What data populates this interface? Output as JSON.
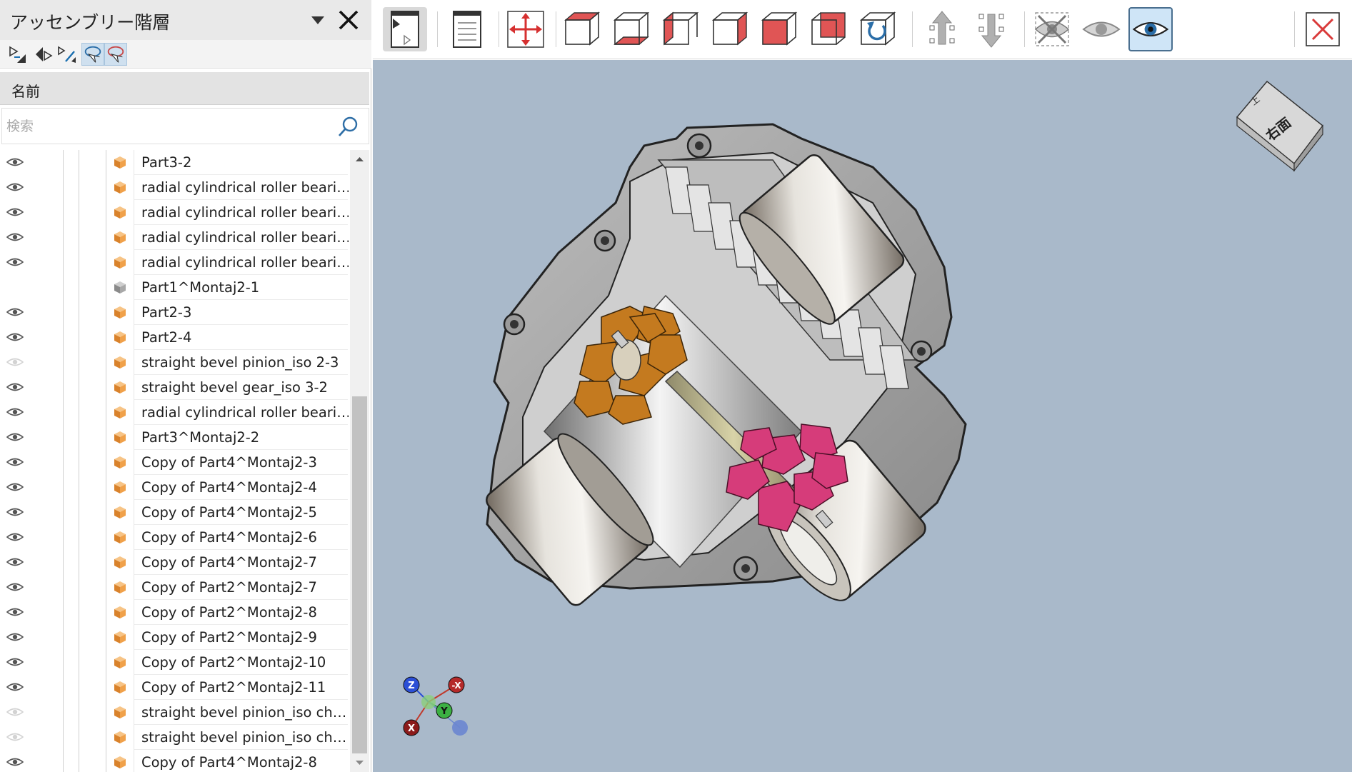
{
  "panel": {
    "title": "アッセンブリー階層",
    "column_header": "名前",
    "search_placeholder": "検索"
  },
  "tree": {
    "rows": [
      {
        "label": "Part3-2",
        "visible": true,
        "icon": "orange-part-icon"
      },
      {
        "label": "radial cylindrical roller beari…",
        "visible": true,
        "icon": "orange-part-icon"
      },
      {
        "label": "radial cylindrical roller beari…",
        "visible": true,
        "icon": "orange-part-icon"
      },
      {
        "label": "radial cylindrical roller beari…",
        "visible": true,
        "icon": "orange-part-icon"
      },
      {
        "label": "radial cylindrical roller beari…",
        "visible": true,
        "icon": "orange-part-icon"
      },
      {
        "label": "Part1^Montaj2-1",
        "visible": null,
        "icon": "gray-part-icon"
      },
      {
        "label": "Part2-3",
        "visible": true,
        "icon": "orange-part-icon"
      },
      {
        "label": "Part2-4",
        "visible": true,
        "icon": "orange-part-icon"
      },
      {
        "label": "straight bevel pinion_iso 2-3",
        "visible": false,
        "icon": "orange-part-icon"
      },
      {
        "label": "straight bevel gear_iso 3-2",
        "visible": true,
        "icon": "orange-part-icon"
      },
      {
        "label": "radial cylindrical roller beari…",
        "visible": true,
        "icon": "orange-part-icon"
      },
      {
        "label": "Part3^Montaj2-2",
        "visible": true,
        "icon": "orange-part-icon"
      },
      {
        "label": "Copy of Part4^Montaj2-3",
        "visible": true,
        "icon": "orange-part-icon"
      },
      {
        "label": "Copy of Part4^Montaj2-4",
        "visible": true,
        "icon": "orange-part-icon"
      },
      {
        "label": "Copy of Part4^Montaj2-5",
        "visible": true,
        "icon": "orange-part-icon"
      },
      {
        "label": "Copy of Part4^Montaj2-6",
        "visible": true,
        "icon": "orange-part-icon"
      },
      {
        "label": "Copy of Part4^Montaj2-7",
        "visible": true,
        "icon": "orange-part-icon"
      },
      {
        "label": "Copy of Part2^Montaj2-7",
        "visible": true,
        "icon": "orange-part-icon"
      },
      {
        "label": "Copy of Part2^Montaj2-8",
        "visible": true,
        "icon": "orange-part-icon"
      },
      {
        "label": "Copy of Part2^Montaj2-9",
        "visible": true,
        "icon": "orange-part-icon"
      },
      {
        "label": "Copy of Part2^Montaj2-10",
        "visible": true,
        "icon": "orange-part-icon"
      },
      {
        "label": "Copy of Part2^Montaj2-11",
        "visible": true,
        "icon": "orange-part-icon"
      },
      {
        "label": "straight bevel pinion_iso ch…",
        "visible": false,
        "icon": "orange-part-icon"
      },
      {
        "label": "straight bevel pinion_iso ch…",
        "visible": false,
        "icon": "orange-part-icon"
      },
      {
        "label": "Copy of Part4^Montaj2-8",
        "visible": true,
        "icon": "orange-part-icon"
      }
    ]
  },
  "view_cube": {
    "face_label": "右面",
    "top_label": "上"
  },
  "triad": {
    "z": "Z",
    "neg_x": "-X",
    "y": "Y",
    "x": "X"
  },
  "colors": {
    "viewport_bg": "#a9b9ca",
    "pinion_orange": "#c47a1f",
    "pinion_pink": "#d63c7a",
    "accent_red": "#d93a3a",
    "active_blue": "#cfe5f7"
  }
}
